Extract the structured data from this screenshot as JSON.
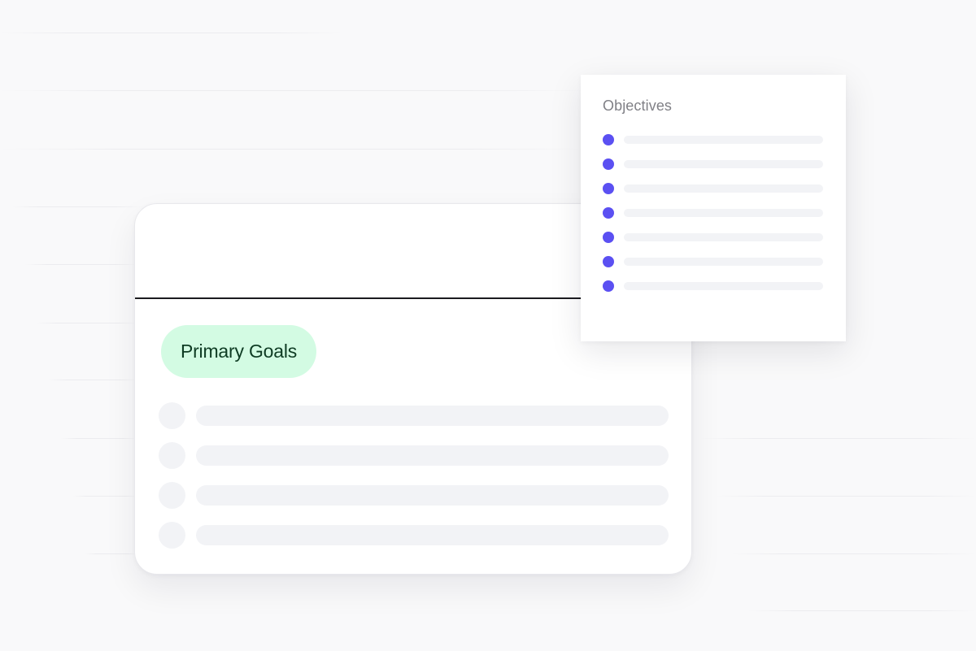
{
  "main_card": {
    "badge_label": "Primary Goals",
    "goal_rows": 4
  },
  "objectives_card": {
    "title": "Objectives",
    "items": 7
  },
  "colors": {
    "background": "#f9f9fa",
    "badge_background": "#d3fbe3",
    "badge_text": "#0e3b23",
    "bullet_accent": "#5b50f2",
    "placeholder": "#f2f3f6",
    "divider": "#1b1b1f"
  }
}
